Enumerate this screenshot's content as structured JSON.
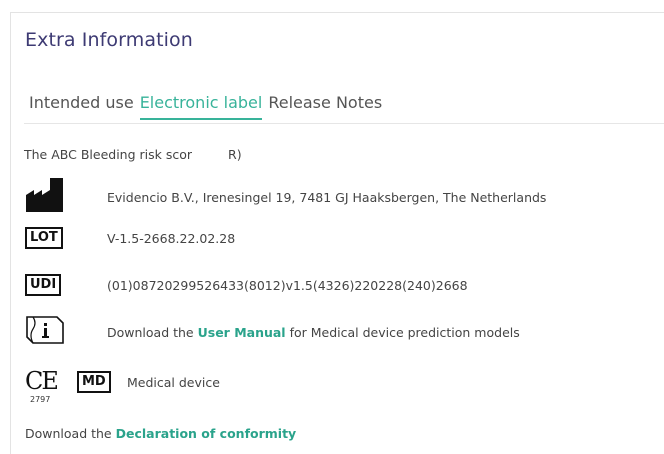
{
  "panel": {
    "title": "Extra Information"
  },
  "tabs": [
    {
      "label": "Intended use",
      "active": false
    },
    {
      "label": "Electronic label",
      "active": true
    },
    {
      "label": "Release Notes",
      "active": false
    }
  ],
  "description": {
    "start": "The ABC Bleeding risk scor",
    "end": "R)"
  },
  "manufacturer": {
    "icon": "factory-icon",
    "text": "Evidencio B.V., Irenesingel 19, 7481 GJ Haaksbergen, The Netherlands"
  },
  "lot": {
    "badge": "LOT",
    "text": "V-1.5-2668.22.02.28"
  },
  "udi": {
    "badge": "UDI",
    "text": "(01)08720299526433(8012)v1.5(4326)220228(240)2668"
  },
  "manual": {
    "icon": "instructions-info-icon",
    "prefix": "Download the ",
    "link": "User Manual",
    "suffix": " for Medical device prediction models"
  },
  "ce": {
    "mark": "CE",
    "number": "2797"
  },
  "md": {
    "badge": "MD",
    "text": "Medical device"
  },
  "declaration": {
    "prefix": "Download the ",
    "link": "Declaration of conformity"
  },
  "colors": {
    "accent": "#38b39a",
    "title": "#3d3a73",
    "link": "#2aa38b"
  }
}
